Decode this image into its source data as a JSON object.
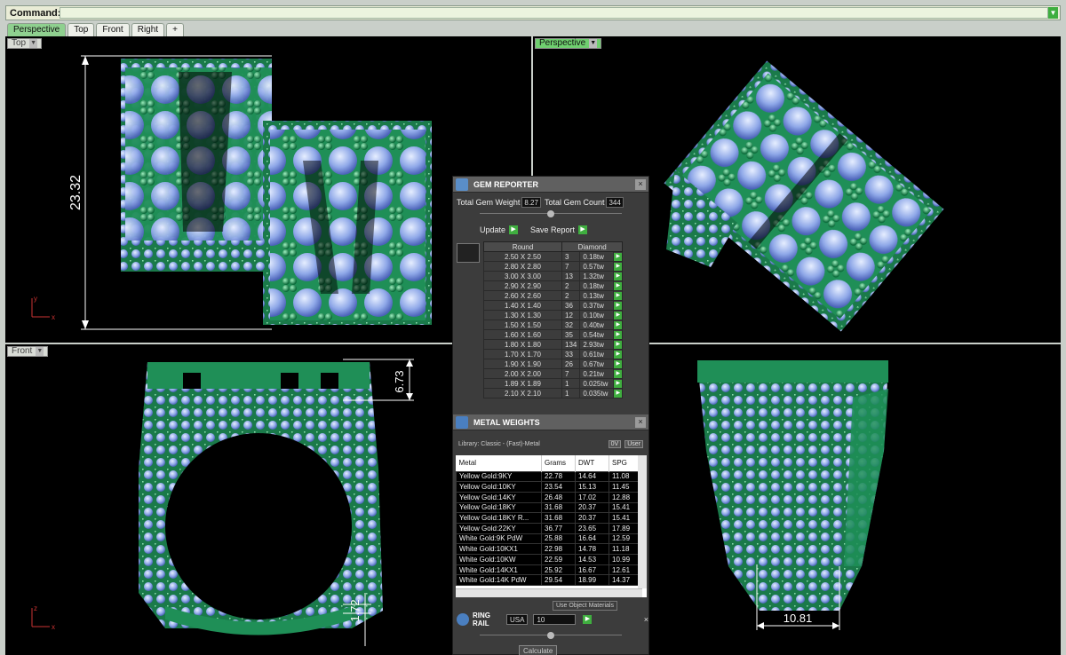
{
  "command": {
    "label": "Command:",
    "value": ""
  },
  "tabs": [
    "Perspective",
    "Top",
    "Front",
    "Right",
    "+"
  ],
  "viewports": {
    "top": {
      "label": "Top",
      "dimension": "23.32",
      "axis_y": "y",
      "axis_x": "x"
    },
    "perspective": {
      "label": "Perspective"
    },
    "front": {
      "label": "Front",
      "dimension_top": "6.73",
      "dimension_bottom": "1.72",
      "axis_z": "z",
      "axis_x": "x"
    },
    "right": {
      "dimension": "10.81"
    }
  },
  "gem_reporter": {
    "title": "GEM REPORTER",
    "total_weight_label": "Total Gem Weight",
    "total_weight": "8.27",
    "total_count_label": "Total Gem Count",
    "total_count": "344",
    "update_label": "Update",
    "save_label": "Save Report",
    "col_shape": "Round",
    "col_material": "Diamond",
    "rows": [
      [
        "2.50 X 2.50",
        "3",
        "0.18tw"
      ],
      [
        "2.80 X 2.80",
        "7",
        "0.57tw"
      ],
      [
        "3.00 X 3.00",
        "13",
        "1.32tw"
      ],
      [
        "2.90 X 2.90",
        "2",
        "0.18tw"
      ],
      [
        "2.60 X 2.60",
        "2",
        "0.13tw"
      ],
      [
        "1.40 X 1.40",
        "36",
        "0.37tw"
      ],
      [
        "1.30 X 1.30",
        "12",
        "0.10tw"
      ],
      [
        "1.50 X 1.50",
        "32",
        "0.40tw"
      ],
      [
        "1.60 X 1.60",
        "35",
        "0.54tw"
      ],
      [
        "1.80 X 1.80",
        "134",
        "2.93tw"
      ],
      [
        "1.70 X 1.70",
        "33",
        "0.61tw"
      ],
      [
        "1.90 X 1.90",
        "26",
        "0.67tw"
      ],
      [
        "2.00 X 2.00",
        "7",
        "0.21tw"
      ],
      [
        "1.89 X 1.89",
        "1",
        "0.025tw"
      ],
      [
        "2.10 X 2.10",
        "1",
        "0.035tw"
      ]
    ]
  },
  "metal_weights": {
    "title": "METAL WEIGHTS",
    "library": "Library: Classic - (Fast)-Metal",
    "btn1": "0V",
    "btn2": "User",
    "headers": [
      "Metal",
      "Grams",
      "DWT",
      "SPG"
    ],
    "rows": [
      [
        "Yellow Gold:9KY",
        "22.78",
        "14.64",
        "11.08"
      ],
      [
        "Yellow Gold:10KY",
        "23.54",
        "15.13",
        "11.45"
      ],
      [
        "Yellow Gold:14KY",
        "26.48",
        "17.02",
        "12.88"
      ],
      [
        "Yellow Gold:18KY",
        "31.68",
        "20.37",
        "15.41"
      ],
      [
        "Yellow Gold:18KY R...",
        "31.68",
        "20.37",
        "15.41"
      ],
      [
        "Yellow Gold:22KY",
        "36.77",
        "23.65",
        "17.89"
      ],
      [
        "White Gold:9K PdW",
        "25.88",
        "16.64",
        "12.59"
      ],
      [
        "White Gold:10KX1",
        "22.98",
        "14.78",
        "11.18"
      ],
      [
        "White Gold:10KW",
        "22.59",
        "14.53",
        "10.99"
      ],
      [
        "White Gold:14KX1",
        "25.92",
        "16.67",
        "12.61"
      ],
      [
        "White Gold:14K PdW",
        "29.54",
        "18.99",
        "14.37"
      ]
    ],
    "use_object": "Use Object Materials"
  },
  "ring_rail": {
    "title": "RING RAIL",
    "standard": "USA",
    "size": "10",
    "calculate": "Calculate"
  }
}
